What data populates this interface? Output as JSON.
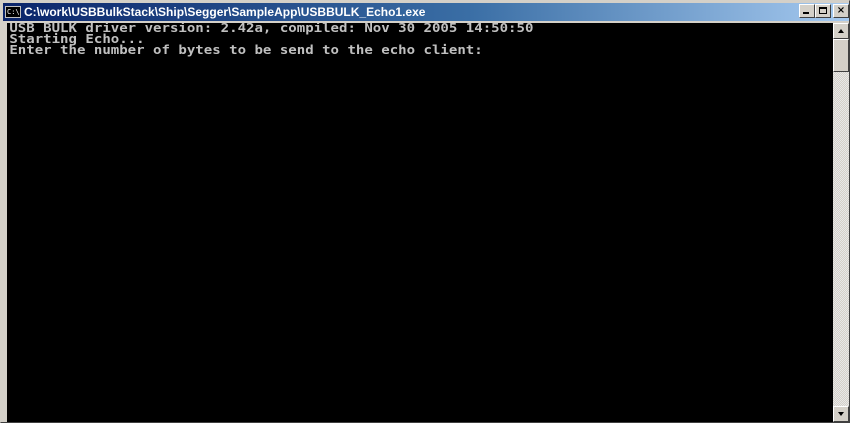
{
  "window": {
    "title": "C:\\work\\USBBulkStack\\Ship\\Segger\\SampleApp\\USBBULK_Echo1.exe",
    "icon_label": "C:\\",
    "icon": "console-app-icon",
    "buttons": {
      "minimize_icon": "minimize-icon",
      "maximize_icon": "maximize-icon",
      "close_label": "×",
      "close_icon": "close-icon"
    }
  },
  "console": {
    "lines": [
      "USB BULK driver version: 2.42a, compiled: Nov 30 2005 14:50:50",
      "Starting Echo...",
      "Enter the number of bytes to be send to the echo client:"
    ]
  },
  "scrollbar": {
    "up_icon": "scroll-up-icon",
    "down_icon": "scroll-down-icon"
  },
  "colors": {
    "titlebar_start": "#0a246a",
    "titlebar_end": "#a6caf0",
    "console_background": "#000000",
    "console_text": "#c0c0c0",
    "chrome": "#d4d0c8"
  }
}
